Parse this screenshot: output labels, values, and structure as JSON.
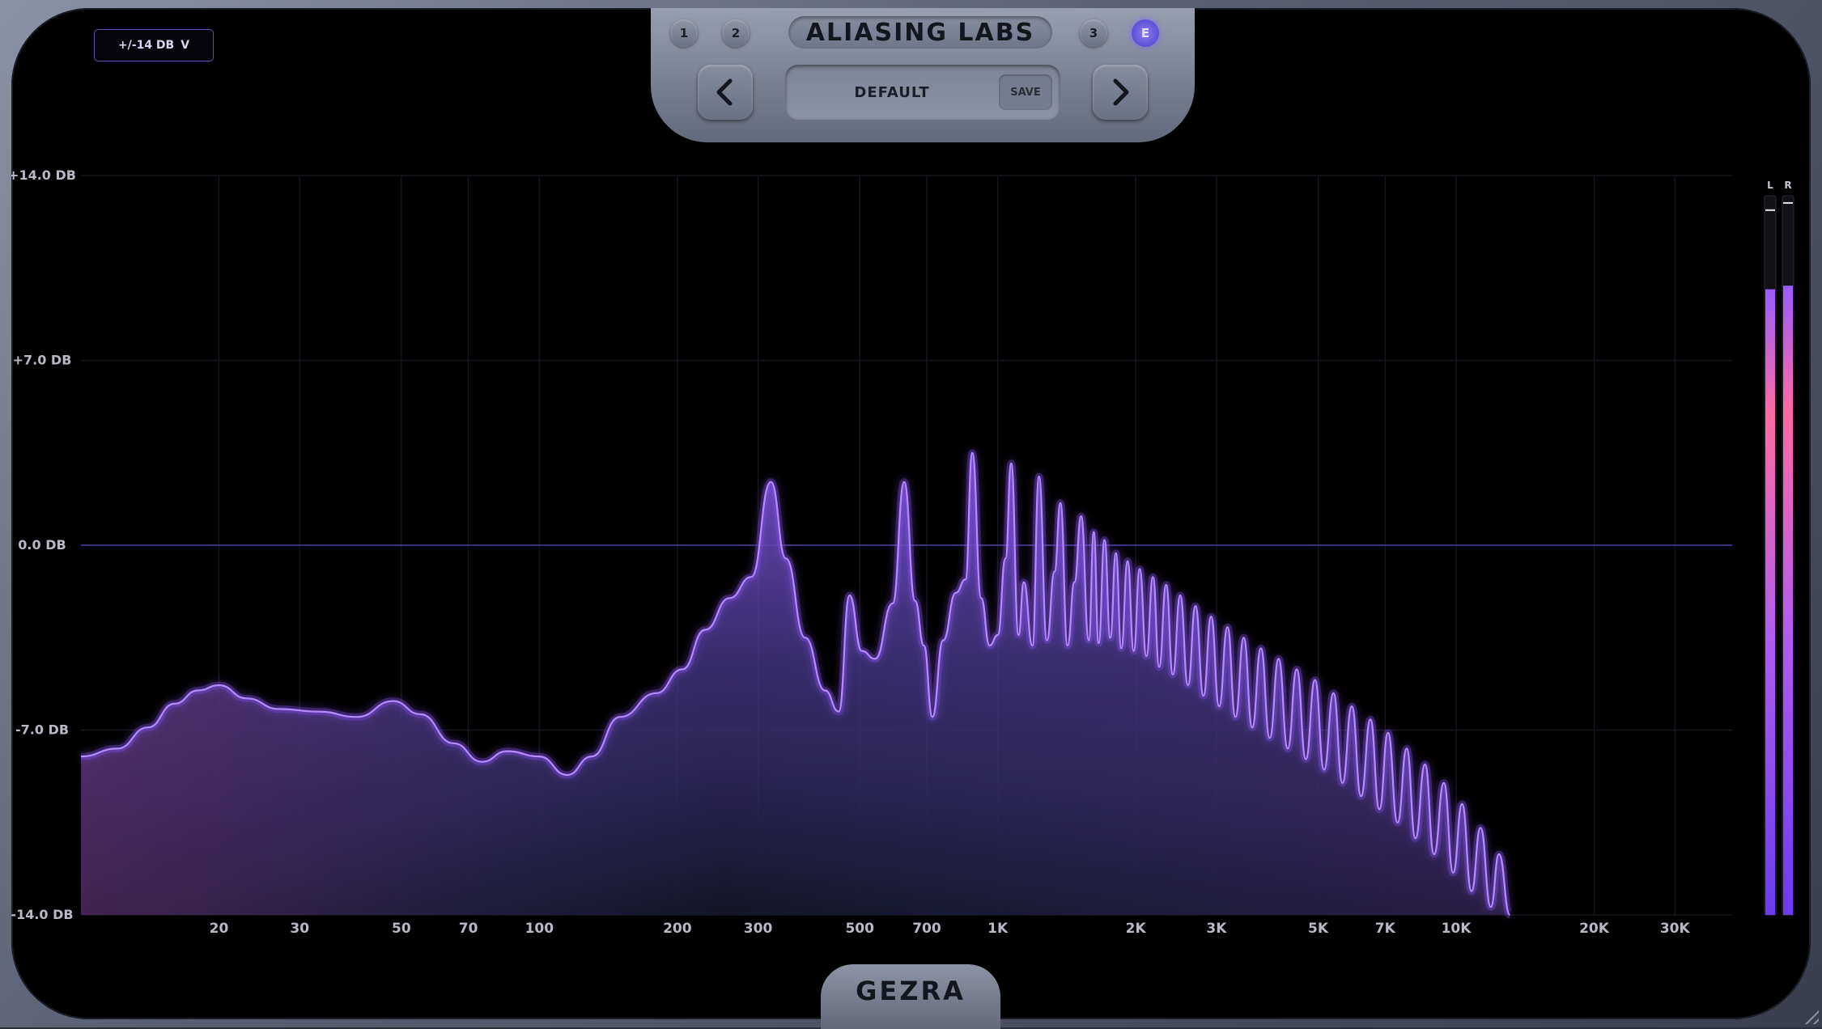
{
  "header": {
    "brand": "ALIASING LABS",
    "preset_slots": [
      {
        "label": "1",
        "active": false
      },
      {
        "label": "2",
        "active": false
      },
      {
        "label": "3",
        "active": false
      },
      {
        "label": "E",
        "active": true
      }
    ],
    "preset_name": "DEFAULT",
    "save_label": "SAVE",
    "prev_icon": "chevron-left-icon",
    "next_icon": "chevron-right-icon"
  },
  "range_selector": {
    "label": "+/-14 DB",
    "icon": "chevron-down-icon",
    "caret": "V"
  },
  "footer": {
    "product": "GEZRA"
  },
  "meters": {
    "left_label": "L",
    "right_label": "R",
    "left_level": 0.87,
    "right_level": 0.875,
    "left_peak": 0.98,
    "right_peak": 0.99
  },
  "colors": {
    "accent": "#9b6cff",
    "curve": "#b48cff",
    "meter_top": "#ff6aa0",
    "meter_bottom": "#7a4cff",
    "zero_line": "#4a44a8"
  },
  "chart_data": {
    "type": "area",
    "x_scale": "log",
    "xlim": [
      10,
      40000
    ],
    "ylim": [
      -14,
      14
    ],
    "x_ticks": [
      {
        "value": 20,
        "label": "20"
      },
      {
        "value": 30,
        "label": "30"
      },
      {
        "value": 50,
        "label": "50"
      },
      {
        "value": 70,
        "label": "70"
      },
      {
        "value": 100,
        "label": "100"
      },
      {
        "value": 200,
        "label": "200"
      },
      {
        "value": 300,
        "label": "300"
      },
      {
        "value": 500,
        "label": "500"
      },
      {
        "value": 700,
        "label": "700"
      },
      {
        "value": 1000,
        "label": "1K"
      },
      {
        "value": 2000,
        "label": "2K"
      },
      {
        "value": 3000,
        "label": "3K"
      },
      {
        "value": 5000,
        "label": "5K"
      },
      {
        "value": 7000,
        "label": "7K"
      },
      {
        "value": 10000,
        "label": "10K"
      },
      {
        "value": 20000,
        "label": "20K"
      },
      {
        "value": 30000,
        "label": "30K"
      }
    ],
    "y_ticks": [
      {
        "value": 14,
        "label": "+14.0 DB"
      },
      {
        "value": 7,
        "label": "+7.0 DB"
      },
      {
        "value": 0,
        "label": "0.0 DB"
      },
      {
        "value": -7,
        "label": "-7.0 DB"
      },
      {
        "value": -14,
        "label": "-14.0 DB"
      }
    ],
    "series": [
      {
        "points": [
          [
            10,
            -8.0
          ],
          [
            12,
            -7.7
          ],
          [
            14,
            -6.9
          ],
          [
            16,
            -6.0
          ],
          [
            18,
            -5.5
          ],
          [
            20,
            -5.3
          ],
          [
            23,
            -5.8
          ],
          [
            27,
            -6.2
          ],
          [
            33,
            -6.3
          ],
          [
            40,
            -6.5
          ],
          [
            48,
            -5.9
          ],
          [
            55,
            -6.4
          ],
          [
            65,
            -7.5
          ],
          [
            75,
            -8.2
          ],
          [
            85,
            -7.8
          ],
          [
            100,
            -8.0
          ],
          [
            115,
            -8.7
          ],
          [
            130,
            -8.0
          ],
          [
            150,
            -6.5
          ],
          [
            180,
            -5.6
          ],
          [
            205,
            -4.7
          ],
          [
            230,
            -3.2
          ],
          [
            260,
            -2.0
          ],
          [
            290,
            -1.2
          ],
          [
            320,
            2.4
          ],
          [
            345,
            -0.5
          ],
          [
            380,
            -3.5
          ],
          [
            420,
            -5.5
          ],
          [
            450,
            -6.3
          ],
          [
            475,
            -1.9
          ],
          [
            505,
            -4.0
          ],
          [
            540,
            -4.3
          ],
          [
            590,
            -2.2
          ],
          [
            625,
            2.4
          ],
          [
            660,
            -2.1
          ],
          [
            690,
            -3.8
          ],
          [
            720,
            -6.5
          ],
          [
            760,
            -3.6
          ],
          [
            810,
            -1.8
          ],
          [
            850,
            -1.3
          ],
          [
            880,
            3.5
          ],
          [
            920,
            -2.0
          ],
          [
            960,
            -3.8
          ],
          [
            1000,
            -3.4
          ],
          [
            1040,
            -0.5
          ],
          [
            1070,
            3.1
          ],
          [
            1110,
            -3.4
          ],
          [
            1140,
            -1.4
          ],
          [
            1190,
            -3.8
          ],
          [
            1230,
            2.6
          ],
          [
            1280,
            -3.6
          ],
          [
            1330,
            -1.0
          ],
          [
            1370,
            1.6
          ],
          [
            1420,
            -3.8
          ],
          [
            1470,
            -1.4
          ],
          [
            1520,
            1.1
          ],
          [
            1580,
            -3.6
          ],
          [
            1620,
            0.5
          ],
          [
            1660,
            -3.7
          ],
          [
            1710,
            0.2
          ],
          [
            1760,
            -3.5
          ],
          [
            1810,
            -0.3
          ],
          [
            1860,
            -3.9
          ],
          [
            1920,
            -0.6
          ],
          [
            1980,
            -4.0
          ],
          [
            2040,
            -0.9
          ],
          [
            2110,
            -4.2
          ],
          [
            2180,
            -1.2
          ],
          [
            2250,
            -4.6
          ],
          [
            2330,
            -1.5
          ],
          [
            2410,
            -4.9
          ],
          [
            2500,
            -1.9
          ],
          [
            2600,
            -5.3
          ],
          [
            2700,
            -2.3
          ],
          [
            2810,
            -5.7
          ],
          [
            2920,
            -2.7
          ],
          [
            3040,
            -6.1
          ],
          [
            3170,
            -3.1
          ],
          [
            3300,
            -6.5
          ],
          [
            3440,
            -3.5
          ],
          [
            3590,
            -6.9
          ],
          [
            3750,
            -3.9
          ],
          [
            3920,
            -7.3
          ],
          [
            4100,
            -4.3
          ],
          [
            4290,
            -7.7
          ],
          [
            4490,
            -4.7
          ],
          [
            4700,
            -8.1
          ],
          [
            4920,
            -5.1
          ],
          [
            5150,
            -8.5
          ],
          [
            5400,
            -5.6
          ],
          [
            5650,
            -9.0
          ],
          [
            5920,
            -6.1
          ],
          [
            6200,
            -9.5
          ],
          [
            6500,
            -6.6
          ],
          [
            6800,
            -10.0
          ],
          [
            7100,
            -7.1
          ],
          [
            7450,
            -10.5
          ],
          [
            7800,
            -7.7
          ],
          [
            8150,
            -11.1
          ],
          [
            8550,
            -8.3
          ],
          [
            8950,
            -11.7
          ],
          [
            9400,
            -9.0
          ],
          [
            9850,
            -12.4
          ],
          [
            10300,
            -9.8
          ],
          [
            10800,
            -13.1
          ],
          [
            11300,
            -10.7
          ],
          [
            11900,
            -13.7
          ],
          [
            12400,
            -11.7
          ],
          [
            13100,
            -14.0
          ]
        ]
      }
    ],
    "zero_line": 0,
    "grid": true
  }
}
